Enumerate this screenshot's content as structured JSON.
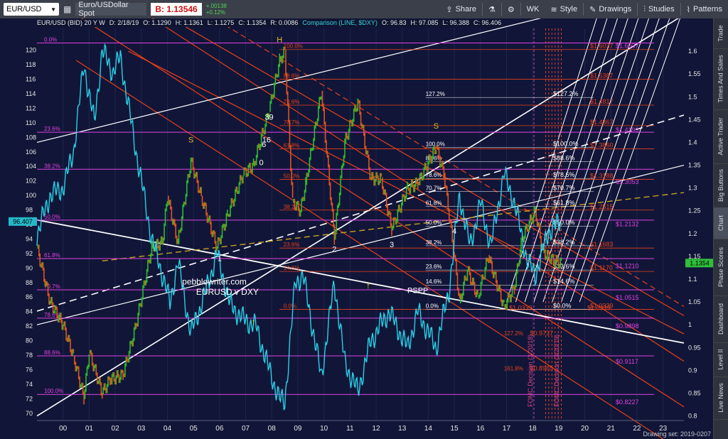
{
  "toolbar": {
    "symbol": "EUR/USD",
    "description": "Euro/USDollar Spot",
    "bid": "B: 1.13546",
    "change_abs": "+.00138",
    "change_pct": "+0.12%",
    "buttons": [
      "Share",
      "WK",
      "Style",
      "Drawings",
      "Studies",
      "Patterns"
    ]
  },
  "info_bar": {
    "title": "EUR/USD (BID) 20 Y W",
    "date": "D: 2/18/19",
    "open": "O: 1.1290",
    "high": "H: 1.1361",
    "low": "L: 1.1275",
    "close": "C: 1.1354",
    "range": "R: 0.0086",
    "comparison": "Comparison (LINE, $DXY)",
    "cmp_open": "O: 96.83",
    "cmp_high": "H: 97.085",
    "cmp_low": "L: 96.388",
    "cmp_close": "C: 96.406"
  },
  "sidebar_tabs": [
    "Trade",
    "Times And Sales",
    "Active Trader",
    "Big Buttons",
    "Chart",
    "Phase Scores",
    "Dashboard",
    "Level II",
    "Live News"
  ],
  "drawing_set": "Drawing set: 2019-0207",
  "colors": {
    "background": "#111638",
    "eurusd_line": "#2ad0e6",
    "candle_up": "#2dbb2d",
    "candle_down": "#e0531e",
    "magenta_levels": "#e040e0",
    "red_channel": "#e8401a",
    "white_lines": "#ffffff",
    "yellow_dashed": "#c8a020"
  },
  "chart_data": {
    "type": "line",
    "title": "",
    "x_ticks": [
      "00",
      "01",
      "02",
      "03",
      "04",
      "05",
      "06",
      "07",
      "08",
      "09",
      "10",
      "11",
      "12",
      "13",
      "14",
      "15",
      "16",
      "17",
      "18",
      "19",
      "20",
      "21",
      "22",
      "23"
    ],
    "x_range": [
      1999.0,
      2023.8
    ],
    "left_axis": {
      "label": "DXY",
      "range": [
        69,
        123
      ],
      "ticks": [
        70,
        72,
        74,
        76,
        78,
        80,
        82,
        84,
        86,
        88,
        90,
        92,
        94,
        96,
        98,
        100,
        102,
        104,
        106,
        108,
        110,
        112,
        114,
        116,
        118,
        120
      ],
      "current": "96.407"
    },
    "right_axis": {
      "label": "EUR/USD",
      "range": [
        0.79,
        1.65
      ],
      "ticks": [
        0.8,
        0.85,
        0.9,
        0.95,
        1,
        1.05,
        1.1,
        1.15,
        1.2,
        1.25,
        1.3,
        1.35,
        1.4,
        1.45,
        1.5,
        1.55,
        1.6
      ],
      "current": "1.1354"
    },
    "series": [
      {
        "name": "EUR/USD",
        "points": [
          [
            1999.0,
            1.17
          ],
          [
            1999.5,
            1.05
          ],
          [
            2000.0,
            1.0
          ],
          [
            2000.4,
            0.93
          ],
          [
            2000.8,
            0.84
          ],
          [
            2001.0,
            0.94
          ],
          [
            2001.5,
            0.85
          ],
          [
            2001.8,
            0.88
          ],
          [
            2002.3,
            0.89
          ],
          [
            2002.8,
            1.0
          ],
          [
            2003.4,
            1.17
          ],
          [
            2003.8,
            1.18
          ],
          [
            2004.0,
            1.28
          ],
          [
            2004.4,
            1.18
          ],
          [
            2004.9,
            1.36
          ],
          [
            2005.3,
            1.28
          ],
          [
            2005.9,
            1.17
          ],
          [
            2006.3,
            1.24
          ],
          [
            2006.9,
            1.33
          ],
          [
            2007.3,
            1.35
          ],
          [
            2007.9,
            1.47
          ],
          [
            2008.3,
            1.58
          ],
          [
            2008.5,
            1.6
          ],
          [
            2008.8,
            1.27
          ],
          [
            2009.1,
            1.25
          ],
          [
            2009.3,
            1.31
          ],
          [
            2009.9,
            1.51
          ],
          [
            2010.4,
            1.19
          ],
          [
            2010.8,
            1.4
          ],
          [
            2011.3,
            1.49
          ],
          [
            2011.8,
            1.32
          ],
          [
            2012.2,
            1.32
          ],
          [
            2012.6,
            1.21
          ],
          [
            2013.2,
            1.3
          ],
          [
            2013.6,
            1.31
          ],
          [
            2014.3,
            1.39
          ],
          [
            2014.6,
            1.33
          ],
          [
            2015.0,
            1.15
          ],
          [
            2015.2,
            1.05
          ],
          [
            2015.5,
            1.12
          ],
          [
            2015.9,
            1.06
          ],
          [
            2016.3,
            1.15
          ],
          [
            2016.9,
            1.04
          ],
          [
            2017.3,
            1.08
          ],
          [
            2017.6,
            1.19
          ],
          [
            2018.1,
            1.25
          ],
          [
            2018.4,
            1.16
          ],
          [
            2018.8,
            1.14
          ],
          [
            2019.1,
            1.135
          ]
        ]
      },
      {
        "name": "$DXY",
        "points": [
          [
            1999.0,
            94.5
          ],
          [
            1999.5,
            100
          ],
          [
            2000.0,
            101
          ],
          [
            2000.4,
            106
          ],
          [
            2000.8,
            118
          ],
          [
            2001.2,
            110
          ],
          [
            2001.5,
            120
          ],
          [
            2001.9,
            117
          ],
          [
            2002.2,
            119
          ],
          [
            2002.8,
            106
          ],
          [
            2003.4,
            94
          ],
          [
            2003.9,
            88
          ],
          [
            2004.1,
            85
          ],
          [
            2004.4,
            91
          ],
          [
            2004.9,
            81
          ],
          [
            2005.4,
            86
          ],
          [
            2005.9,
            92
          ],
          [
            2006.4,
            85
          ],
          [
            2006.9,
            83
          ],
          [
            2007.4,
            82
          ],
          [
            2007.9,
            76
          ],
          [
            2008.3,
            72
          ],
          [
            2008.5,
            71.5
          ],
          [
            2008.9,
            88
          ],
          [
            2009.2,
            89
          ],
          [
            2009.9,
            75
          ],
          [
            2010.4,
            88
          ],
          [
            2010.8,
            77
          ],
          [
            2011.3,
            73
          ],
          [
            2011.8,
            80
          ],
          [
            2012.5,
            84
          ],
          [
            2013.2,
            79
          ],
          [
            2013.6,
            84
          ],
          [
            2014.3,
            79
          ],
          [
            2014.8,
            87
          ],
          [
            2015.2,
            100
          ],
          [
            2015.6,
            93
          ],
          [
            2016.0,
            99
          ],
          [
            2016.4,
            93
          ],
          [
            2016.9,
            103
          ],
          [
            2017.3,
            99
          ],
          [
            2017.8,
            91
          ],
          [
            2018.1,
            89
          ],
          [
            2018.6,
            95
          ],
          [
            2019.1,
            96.4
          ]
        ]
      }
    ],
    "annotations": [
      {
        "text": "H",
        "x": 2008.3,
        "y": 1.62,
        "axis": "right",
        "color": "#e0c020"
      },
      {
        "text": "S",
        "x": 2004.9,
        "y": 1.4,
        "axis": "right",
        "color": "#e0c020"
      },
      {
        "text": "S",
        "x": 2014.3,
        "y": 1.43,
        "axis": "right",
        "color": "#e0c020"
      },
      {
        "text": "39",
        "x": 2007.9,
        "y": 1.45,
        "axis": "right",
        "color": "#ffffff"
      },
      {
        "text": "16",
        "x": 2007.8,
        "y": 1.4,
        "axis": "right",
        "color": "#ffffff"
      },
      {
        "text": "6",
        "x": 2007.7,
        "y": 1.39,
        "axis": "right",
        "color": "#ffffff"
      },
      {
        "text": "0",
        "x": 2007.6,
        "y": 1.35,
        "axis": "right",
        "color": "#ffffff"
      },
      {
        "text": "1",
        "x": 2006.0,
        "y": 1.14,
        "axis": "right",
        "color": "#ffffff"
      },
      {
        "text": "2",
        "x": 2010.4,
        "y": 1.16,
        "axis": "right",
        "color": "#ffffff"
      },
      {
        "text": "3",
        "x": 2012.6,
        "y": 1.17,
        "axis": "right",
        "color": "#ffffff"
      },
      {
        "text": "4",
        "x": 2015.0,
        "y": 1.2,
        "axis": "right",
        "color": "#ffffff"
      },
      {
        "text": "pebblewriter.com",
        "x": 2005.8,
        "y": 1.088,
        "axis": "right",
        "color": "#ffffff"
      },
      {
        "text": "EURUSD v DXY",
        "x": 2006.3,
        "y": 1.066,
        "axis": "right",
        "color": "#ffffff"
      },
      {
        "text": "PSPP",
        "x": 2013.6,
        "y": 1.07,
        "axis": "right",
        "color": "#ffffff"
      },
      {
        "text": "FOMC Decision (3/20/18)",
        "x": 2018.0,
        "y": 0.82,
        "axis": "right",
        "color": "#e04080"
      },
      {
        "text": "FOMC Decision (3/20/19)",
        "x": 2019.0,
        "y": 0.82,
        "axis": "right",
        "color": "#e04080"
      }
    ],
    "fib_levels_left": [
      {
        "label": "0.0%",
        "y": 121.0
      },
      {
        "label": "23.6%",
        "y": 108.7
      },
      {
        "label": "38.2%",
        "y": 103.6
      },
      {
        "label": "50.0%",
        "y": 96.6
      },
      {
        "label": "61.8%",
        "y": 91.3
      },
      {
        "label": "70.7%",
        "y": 87.0
      },
      {
        "label": "78.6%",
        "y": 83.1
      },
      {
        "label": "88.6%",
        "y": 77.9
      },
      {
        "label": "100.0%",
        "y": 72.6
      }
    ],
    "fib_levels_red": [
      {
        "label": "100.0%",
        "y": 1.6037
      },
      {
        "label": "88.6%",
        "y": 1.5387
      },
      {
        "label": "78.6%",
        "y": 1.4817
      },
      {
        "label": "70.7%",
        "y": 1.4367
      },
      {
        "label": "61.8%",
        "y": 1.386
      },
      {
        "label": "50.0%",
        "y": 1.3188
      },
      {
        "label": "38.2%",
        "y": 1.2515
      },
      {
        "label": "23.6%",
        "y": 1.1683
      },
      {
        "label": "14.6%",
        "y": 1.117
      },
      {
        "label": "0.0%",
        "y": 1.0339
      }
    ],
    "fib_levels_right": [
      {
        "label": "1.6037",
        "y": 1.6037
      },
      {
        "label": "1.4193",
        "y": 1.4193
      },
      {
        "label": "1.3053",
        "y": 1.3053
      },
      {
        "label": "1.2132",
        "y": 1.2132
      },
      {
        "label": "1.1210",
        "y": 1.121
      },
      {
        "label": "1.0515",
        "y": 1.0515
      },
      {
        "label": "0.9898",
        "y": 0.9898
      },
      {
        "label": "0.9117",
        "y": 0.9117
      },
      {
        "label": "0.8227",
        "y": 0.8227
      }
    ],
    "fib_levels_white": [
      {
        "label": "127.2%",
        "y": 1.4986
      },
      {
        "label": "100.0%",
        "y": 1.3892
      },
      {
        "label": "88.6%",
        "y": 1.3576
      },
      {
        "label": "78.6%",
        "y": 1.321
      },
      {
        "label": "70.7%",
        "y": 1.2922
      },
      {
        "label": "61.8%",
        "y": 1.2597
      },
      {
        "label": "50.0%",
        "y": 1.2165
      },
      {
        "label": "38.2%",
        "y": 1.1734
      },
      {
        "label": "23.6%",
        "y": 1.1201
      },
      {
        "label": "14.6%",
        "y": 1.0872
      },
      {
        "label": "0.0%",
        "y": 1.0339
      }
    ],
    "fib_ext_red": [
      {
        "label": "127.2%",
        "y": 0.9737
      },
      {
        "label": "161.8%",
        "y": 0.8965
      }
    ],
    "misc_red_values": [
      {
        "label": "1.0339",
        "y": 1.0339
      },
      {
        "label": "1.0339",
        "y": 1.0339
      }
    ]
  }
}
